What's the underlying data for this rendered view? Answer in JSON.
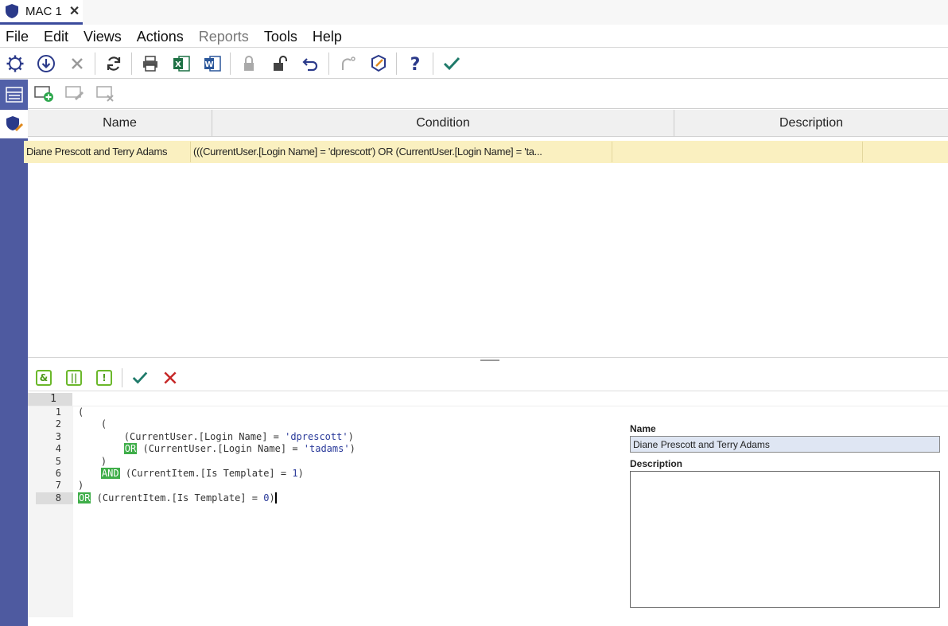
{
  "tab": {
    "label": "MAC 1",
    "close": "✕"
  },
  "menu": [
    "File",
    "Edit",
    "Views",
    "Actions",
    "Reports",
    "Tools",
    "Help"
  ],
  "menu_disabled": [
    "Reports"
  ],
  "grid": {
    "columns": [
      "Name",
      "Condition",
      "Description"
    ],
    "row": {
      "name": "Diane Prescott and Terry Adams",
      "condition": "(((CurrentUser.[Login Name] = 'dprescott') OR (CurrentUser.[Login Name] = 'ta...",
      "description": ""
    }
  },
  "editor": {
    "top_line_number": "1",
    "lines": [
      {
        "n": "1",
        "parts": [
          {
            "t": "("
          }
        ]
      },
      {
        "n": "2",
        "parts": [
          {
            "t": "    ("
          }
        ]
      },
      {
        "n": "3",
        "parts": [
          {
            "t": "        (CurrentUser.[Login Name] = "
          },
          {
            "t": "'dprescott'",
            "c": "str"
          },
          {
            "t": ")"
          }
        ]
      },
      {
        "n": "4",
        "parts": [
          {
            "t": "        "
          },
          {
            "t": "OR",
            "c": "kw"
          },
          {
            "t": " (CurrentUser.[Login Name] = "
          },
          {
            "t": "'tadams'",
            "c": "str"
          },
          {
            "t": ")"
          }
        ]
      },
      {
        "n": "5",
        "parts": [
          {
            "t": "    )"
          }
        ]
      },
      {
        "n": "6",
        "parts": [
          {
            "t": "    "
          },
          {
            "t": "AND",
            "c": "kw"
          },
          {
            "t": " (CurrentItem.[Is Template] = "
          },
          {
            "t": "1",
            "c": "num"
          },
          {
            "t": ")"
          }
        ]
      },
      {
        "n": "7",
        "parts": [
          {
            "t": ")"
          }
        ]
      },
      {
        "n": "8",
        "parts": [
          {
            "t": "OR",
            "c": "kw"
          },
          {
            "t": " (CurrentItem.[Is Template] = "
          },
          {
            "t": "0",
            "c": "num"
          },
          {
            "t": ")"
          }
        ],
        "current": true
      }
    ]
  },
  "props": {
    "name_label": "Name",
    "name_value": "Diane Prescott and Terry Adams",
    "description_label": "Description",
    "description_value": ""
  },
  "colors": {
    "accent": "#3a4a9c",
    "rail": "#4e5aa0",
    "row_highlight": "#faf0c0",
    "keyword": "#3fae49"
  }
}
